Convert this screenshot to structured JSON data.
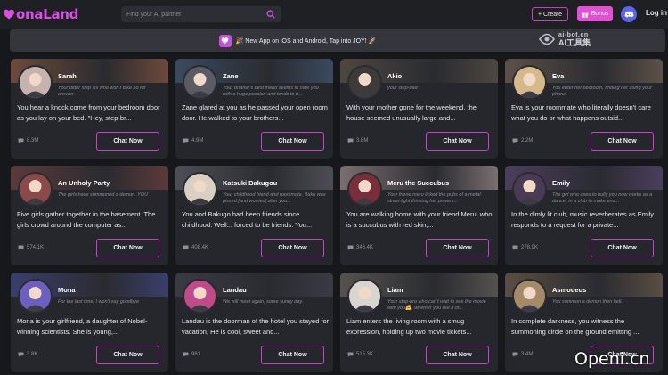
{
  "header": {
    "logo_text": "onaLand",
    "search_placeholder": "Find your AI partner",
    "create_label": "+ Create",
    "bonus_label": "Bonus",
    "login_label": "Log in"
  },
  "banner": {
    "text": "🎉 New App on iOS and Android, Tap into JOY! 🚀"
  },
  "watermarks": {
    "top_line1": "ai-bot.cn",
    "top_line2": "AI工具集",
    "bottom": "Openi.cn"
  },
  "colors": {
    "accent": "#d84fe3",
    "bonus": "#e44fd8",
    "discord": "#5865f2",
    "card": "#26272c",
    "background": "#17181c"
  },
  "cards": [
    {
      "name": "Sarah",
      "tagline": "Your older step sis who won't take no for answer.",
      "description": "You hear a knock come from your bedroom door as you lay on your bed. \"Hey, step-br...",
      "count": "8.3M",
      "button": "Chat Now",
      "cover": "#6d4a3a",
      "avatar": "#c7b3ae"
    },
    {
      "name": "Zane",
      "tagline": "Your brother's best friend seems to hate you with a huge passion and tends to b...",
      "description": "Zane glared at you as he passed your open room door. He walked to your brothers...",
      "count": "4.9M",
      "button": "Chat Now",
      "cover": "#3a4a5e",
      "avatar": "#5b5b66"
    },
    {
      "name": "Akio",
      "tagline": "your step-dad",
      "description": "With your mother gone for the weekend, the house seemed unusually large and...",
      "count": "3.8M",
      "button": "Chat Now",
      "cover": "#4d4740",
      "avatar": "#3e3a3a"
    },
    {
      "name": "Eva",
      "tagline": "You enter her bedroom, finding her using your phone",
      "description": "Eva is your roommate who literally doesn't care what you do or what happens outsid...",
      "count": "2.2M",
      "button": "Chat Now",
      "cover": "#5c5148",
      "avatar": "#d6b98b"
    },
    {
      "name": "An Unholy Party",
      "tagline": "The girls have summoned a demon. YOU",
      "description": "Five girls gather together in the basement. The girls crowd around the computer as...",
      "count": "574.1K",
      "button": "Chat Now",
      "cover": "#5b3a3a",
      "avatar": "#8a4a4a"
    },
    {
      "name": "Katsuki Bakugou",
      "tagline": "Your childhood friend and roommate, Baku was pissed [and worried] after you...",
      "description": "You and Bakugo had been friends since childhood. Well... forced to be friends. You...",
      "count": "408.4K",
      "button": "Chat Now",
      "cover": "#4e4d55",
      "avatar": "#d9cfc2"
    },
    {
      "name": "Meru the Succubus",
      "tagline": "Your friend meru licked the pubs of a metal street light thinking her powers...",
      "description": "You are walking home with your friend Meru, who is a succubus with red skin,...",
      "count": "346.4K",
      "button": "Chat Now",
      "cover": "#7a6f70",
      "avatar": "#7a2e3a"
    },
    {
      "name": "Emily",
      "tagline": "The girl who used to bully you now works as a dancer in a club to make end...",
      "description": "In the dimly lit club, music reverberates as Emily responds to a request for a private...",
      "count": "278.9K",
      "button": "Chat Now",
      "cover": "#4a3f5c",
      "avatar": "#4a3a55"
    },
    {
      "name": "Mona",
      "tagline": "For the last time, I won't say goodbye",
      "description": "Mona is your girlfriend, a daughter of Nobel-winning scientists. She is young,...",
      "count": "3.8K",
      "button": "Chat Now",
      "cover": "#3a3f6a",
      "avatar": "#6d5fc0"
    },
    {
      "name": "Landau",
      "tagline": "We will meet again, some sunny day.",
      "description": "Landau is the doorman of the hotel you stayed for vacation, He is cool, sweet and...",
      "count": "961",
      "button": "Chat Now",
      "cover": "#3a3a44",
      "avatar": "#c24a8a"
    },
    {
      "name": "Liam",
      "tagline": "Your step-bro who can't wait to see the movie with you🤗, whether you like it or...",
      "description": "Liam enters the living room with a smug expression, holding up two movie tickets...",
      "count": "515.3K",
      "button": "Chat Now",
      "cover": "#55524e",
      "avatar": "#d8d4cf"
    },
    {
      "name": "Asmodeus",
      "tagline": "You summon a demon then hell.",
      "description": "In complete darkness, you witness the summoning circle on the ground emitting ...",
      "count": "3.4M",
      "button": "Chat Now",
      "cover": "#5a4e44",
      "avatar": "#a58a6a"
    }
  ]
}
